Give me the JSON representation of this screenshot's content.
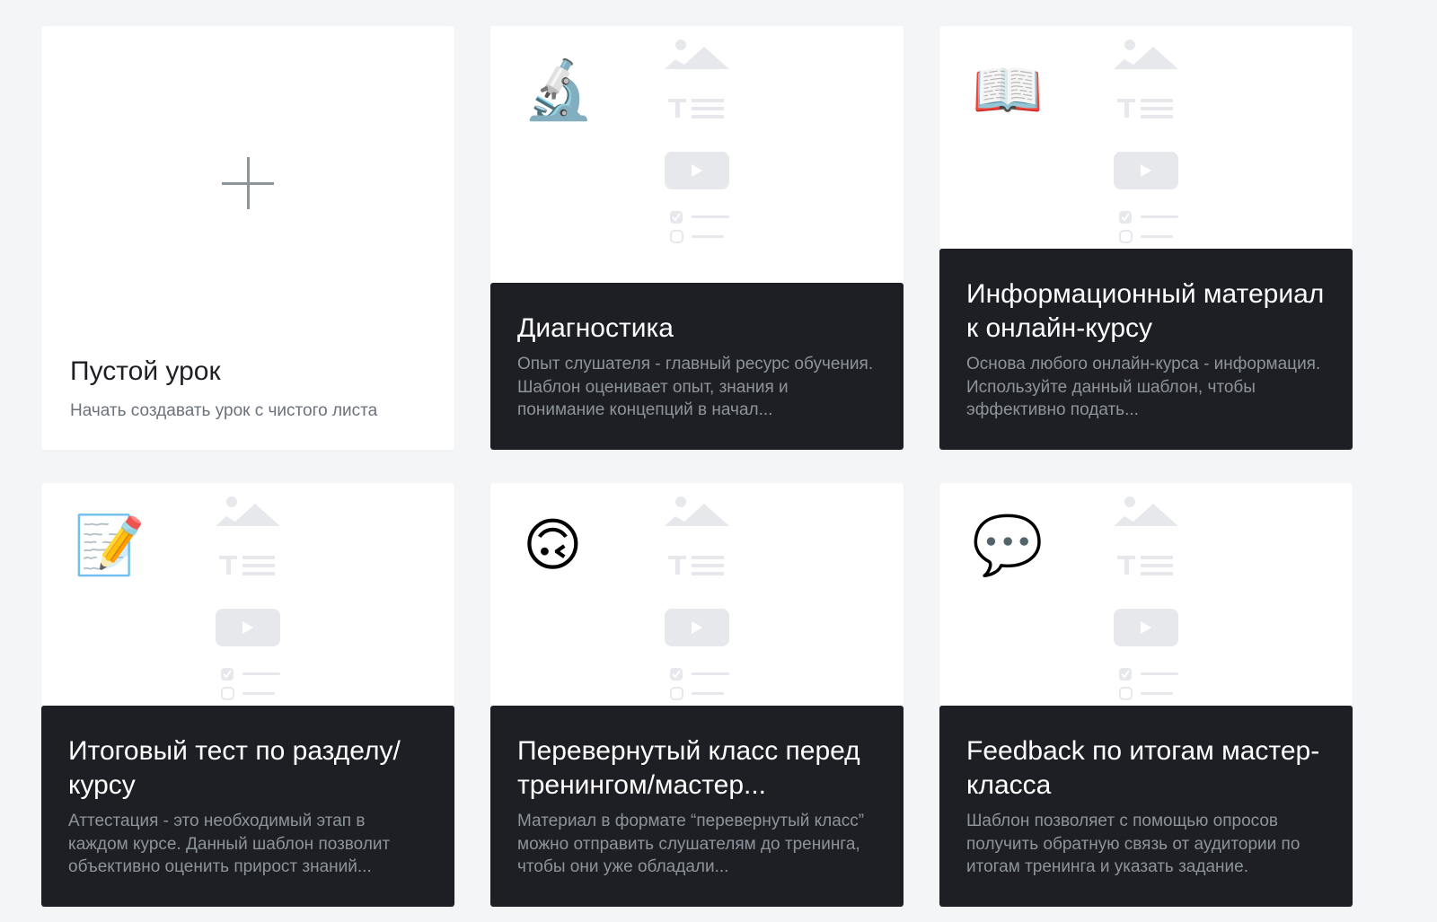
{
  "icon_names": {
    "empty": "plus-icon",
    "diagnostics": "microscope-icon",
    "info": "open-book-icon",
    "final_test": "memo-pencil-icon",
    "flipped": "upside-down-face-icon",
    "feedback": "speech-bubble-icon",
    "placeholder": [
      "image-icon",
      "text-icon",
      "video-play-icon",
      "checklist-icon"
    ]
  },
  "colors": {
    "page_background": "#f4f5f7",
    "card_background": "#ffffff",
    "dark_footer": "#1d1f24",
    "placeholder_gray": "#e6e8ec"
  },
  "cards": {
    "empty": {
      "title": "Пустой урок",
      "description": "Начать создавать урок с чистого листа"
    },
    "diagnostics": {
      "emoji": "🔬",
      "title": "Диагностика",
      "description": "Опыт слушателя - главный ресурс обучения. Шаблон оценивает опыт, знания и понимание концепций в начал..."
    },
    "info": {
      "emoji": "📖",
      "title": "Информационный материал к онлайн-курсу",
      "description": "Основа любого онлайн-курса - информация. Используйте данный шаблон, чтобы эффективно подать..."
    },
    "final_test": {
      "emoji": "📝",
      "title": "Итоговый тест по разделу/курсу",
      "description": "Аттестация - это необходимый этап в каждом курсе. Данный шаблон позволит объективно оценить прирост знаний..."
    },
    "flipped": {
      "emoji": "🙃",
      "title": "Перевернутый класс перед тренингом/мастер...",
      "description": "Материал в формате “перевернутый класс” можно отправить слушателям до тренинга, чтобы они уже обладали..."
    },
    "feedback": {
      "emoji": "💬",
      "title": "Feedback по итогам мастер-класса",
      "description": "Шаблон позволяет с помощью опросов получить обратную связь от аудитории по итогам тренинга и указать задание."
    }
  }
}
